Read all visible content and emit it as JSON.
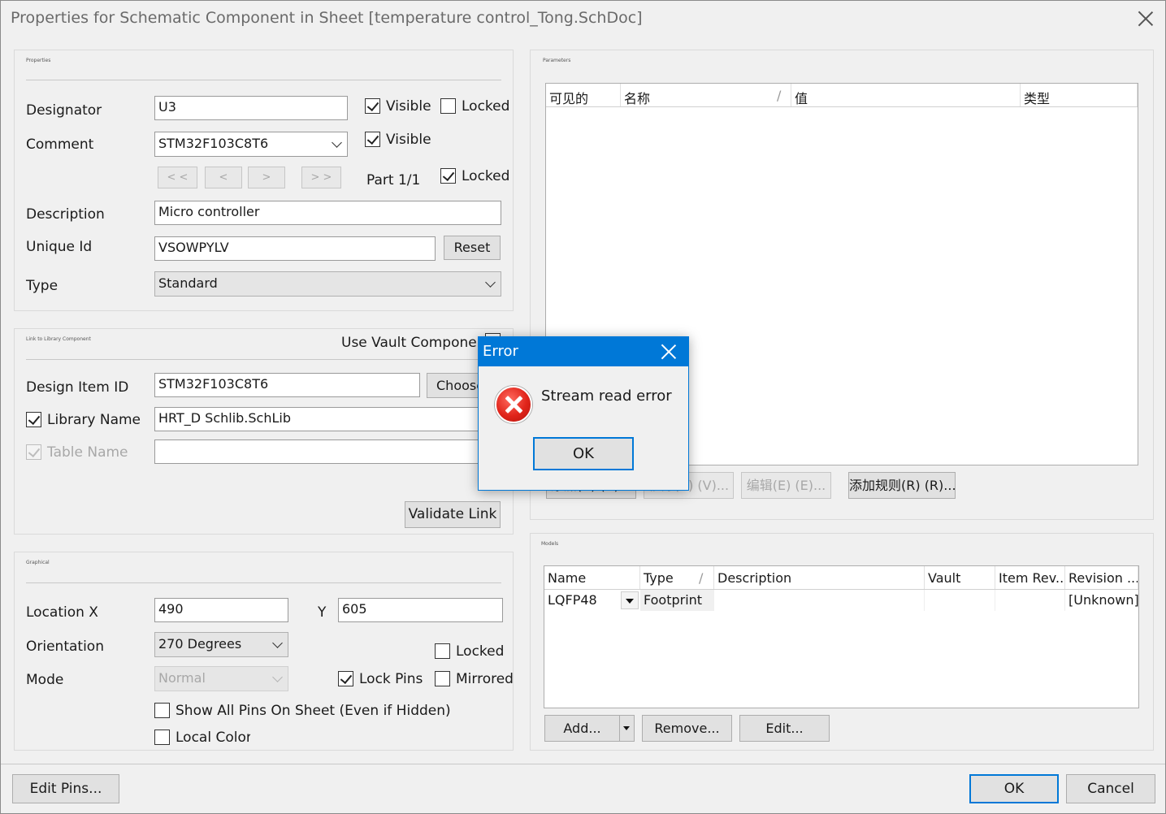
{
  "window": {
    "title": "Properties for Schematic Component in Sheet [temperature control_Tong.SchDoc]"
  },
  "properties": {
    "title": "Properties",
    "designator_label": "Designator",
    "designator_value": "U3",
    "designator_visible": "Visible",
    "designator_locked": "Locked",
    "comment_label": "Comment",
    "comment_value": "STM32F103C8T6",
    "comment_visible": "Visible",
    "nav": [
      "< <",
      "<",
      ">",
      "> >"
    ],
    "part": "Part 1/1",
    "part_locked": "Locked",
    "description_label": "Description",
    "description_value": "Micro controller",
    "unique_id_label": "Unique Id",
    "unique_id_value": "VSOWPYLV",
    "reset": "Reset",
    "type_label": "Type",
    "type_value": "Standard"
  },
  "link": {
    "title": "Link to Library Component",
    "use_vault": "Use Vault Component",
    "design_item_label": "Design Item ID",
    "design_item_value": "STM32F103C8T6",
    "choose": "Choose",
    "library_name_label": "Library Name",
    "library_name_value": "HRT_D Schlib.SchLib",
    "table_name_label": "Table Name",
    "validate": "Validate Link"
  },
  "graphical": {
    "title": "Graphical",
    "location_label": "Location  X",
    "x_value": "490",
    "y_label": "Y",
    "y_value": "605",
    "orientation_label": "Orientation",
    "orientation_value": "270 Degrees",
    "locked": "Locked",
    "mode_label": "Mode",
    "mode_value": "Normal",
    "lock_pins": "Lock Pins",
    "mirrored": "Mirrored",
    "show_all_pins": "Show All Pins On Sheet (Even if Hidden)",
    "local_colors": "Local Colors"
  },
  "parameters": {
    "title": "Parameters",
    "headers": [
      "可见的",
      "名称",
      "值",
      "类型"
    ],
    "sort_mark": "/",
    "buttons": [
      "添加(A) (A)...",
      "移除(V) (V)...",
      "编辑(E) (E)...",
      "添加规则(R) (R)..."
    ]
  },
  "models": {
    "title": "Models",
    "headers": [
      "Name",
      "Type",
      "Description",
      "Vault",
      "Item Rev...",
      "Revision ..."
    ],
    "sort_mark": "/",
    "rows": [
      {
        "name": "LQFP48",
        "type": "Footprint",
        "description": "",
        "vault": "",
        "item_rev": "",
        "revision": "[Unknown]"
      }
    ],
    "add": "Add...",
    "remove": "Remove...",
    "edit": "Edit..."
  },
  "footer": {
    "edit_pins": "Edit Pins...",
    "ok": "OK",
    "cancel": "Cancel"
  },
  "error_dialog": {
    "title": "Error",
    "message": "Stream read error",
    "ok": "OK"
  },
  "icons": [
    "close-icon",
    "chevron-down-icon",
    "checkbox-icon",
    "error-icon",
    "dropdown-arrow-icon"
  ]
}
